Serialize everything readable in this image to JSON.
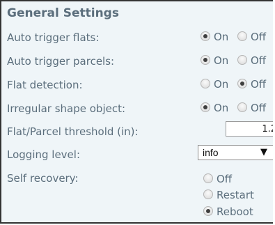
{
  "section": {
    "title": "General Settings"
  },
  "settings": {
    "auto_trigger_flats": {
      "label": "Auto trigger flats:",
      "options": [
        "On",
        "Off"
      ],
      "selected": "On"
    },
    "auto_trigger_parcels": {
      "label": "Auto trigger parcels:",
      "options": [
        "On",
        "Off"
      ],
      "selected": "On"
    },
    "flat_detection": {
      "label": "Flat detection:",
      "options": [
        "On",
        "Off"
      ],
      "selected": "Off"
    },
    "irregular_shape_object": {
      "label": "Irregular shape object:",
      "options": [
        "On",
        "Off"
      ],
      "selected": "On"
    },
    "threshold": {
      "label": "Flat/Parcel threshold (in):",
      "value": "1.2"
    },
    "logging_level": {
      "label": "Logging level:",
      "value": "info",
      "arrow": "▼"
    },
    "self_recovery": {
      "label": "Self recovery:",
      "options": [
        "Off",
        "Restart",
        "Reboot"
      ],
      "selected": "Reboot"
    }
  }
}
